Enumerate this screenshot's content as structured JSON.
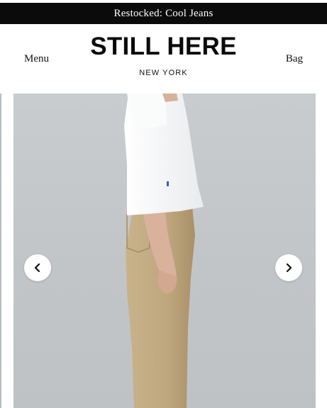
{
  "announcement": {
    "text": "Restocked: Cool Jeans"
  },
  "header": {
    "menu_label": "Menu",
    "brand_name": "STILL HERE",
    "brand_location": "NEW YORK",
    "bag_label": "Bag"
  },
  "carousel": {
    "prev_icon": "chevron-left-icon",
    "next_icon": "chevron-right-icon"
  },
  "colors": {
    "announcement_bg": "#0b0b0b",
    "announcement_text": "#ffffff",
    "photo_background": "#c5c8cb",
    "jeans_khaki": "#c1aa81",
    "tshirt_white": "#f6f7f8"
  }
}
